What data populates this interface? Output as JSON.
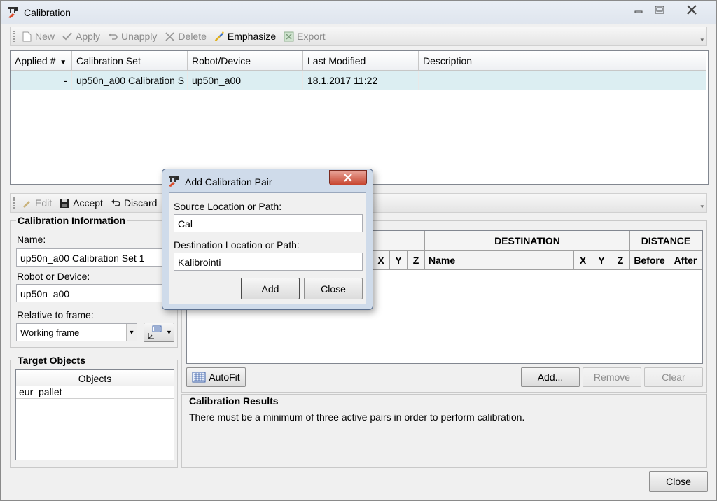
{
  "window": {
    "title": "Calibration"
  },
  "toolbar1": {
    "items": [
      {
        "label": "New",
        "icon": "new-document-icon",
        "enabled": false
      },
      {
        "label": "Apply",
        "icon": "check-icon",
        "enabled": false
      },
      {
        "label": "Unapply",
        "icon": "undo-icon",
        "enabled": false
      },
      {
        "label": "Delete",
        "icon": "delete-x-icon",
        "enabled": false
      },
      {
        "label": "Emphasize",
        "icon": "emphasize-icon",
        "enabled": true
      },
      {
        "label": "Export",
        "icon": "excel-icon",
        "enabled": false
      }
    ]
  },
  "sets_grid": {
    "columns": [
      "Applied #",
      "Calibration Set",
      "Robot/Device",
      "Last Modified",
      "Description"
    ],
    "rows": [
      {
        "applied": "-",
        "set": "up50n_a00 Calibration S",
        "robot": "up50n_a00",
        "modified": "18.1.2017 11:22",
        "description": ""
      }
    ]
  },
  "toolbar2": {
    "edit": "Edit",
    "accept": "Accept",
    "discard": "Discard"
  },
  "calibration_info": {
    "heading": "Calibration Information",
    "name_label": "Name:",
    "name_value": "up50n_a00 Calibration Set 1",
    "robot_label": "Robot or Device:",
    "robot_value": "up50n_a00",
    "frame_label": "Relative to frame:",
    "frame_value": "Working frame"
  },
  "target_objects": {
    "heading": "Target Objects",
    "column": "Objects",
    "items": [
      "eur_pallet"
    ]
  },
  "pairs_grid": {
    "group_destination": "DESTINATION",
    "group_distance": "DISTANCE",
    "cols_source": [
      "X",
      "Y",
      "Z"
    ],
    "col_name": "Name",
    "cols_dest": [
      "X",
      "Y",
      "Z"
    ],
    "col_before": "Before",
    "col_after": "After"
  },
  "pair_buttons": {
    "autofit": "AutoFit",
    "add": "Add...",
    "remove": "Remove",
    "clear": "Clear"
  },
  "results": {
    "heading": "Calibration Results",
    "message": "There must be a minimum of three active pairs in order to perform calibration."
  },
  "footer": {
    "close": "Close"
  },
  "dialog": {
    "title": "Add Calibration Pair",
    "source_label": "Source Location or Path:",
    "source_value": "Cal",
    "dest_label": "Destination Location or Path:",
    "dest_value": "Kalibrointi",
    "add": "Add",
    "close": "Close"
  }
}
